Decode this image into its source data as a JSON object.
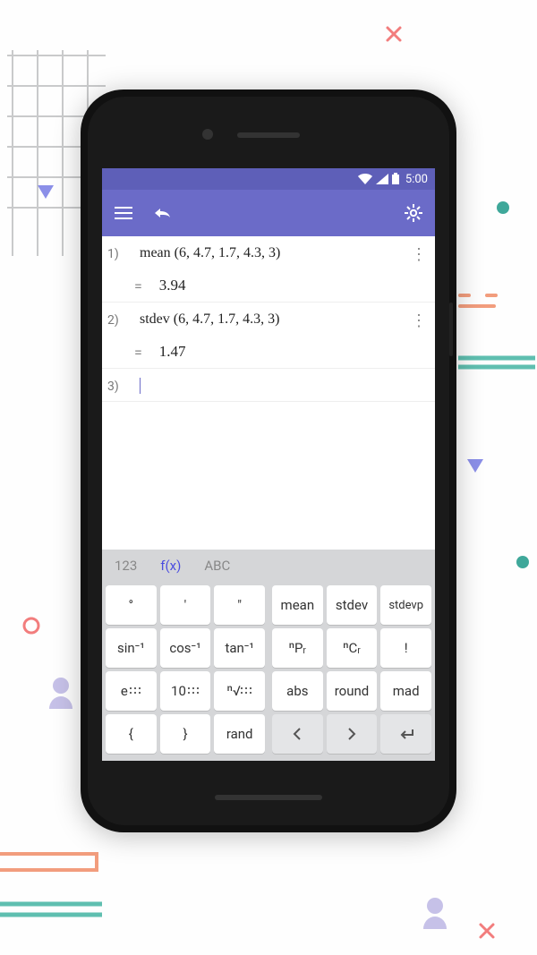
{
  "statusbar": {
    "time": "5:00"
  },
  "history": [
    {
      "num": "1)",
      "expr": "mean (6, 4.7, 1.7, 4.3, 3)",
      "result": "3.94"
    },
    {
      "num": "2)",
      "expr": "stdev (6, 4.7, 1.7, 4.3, 3)",
      "result": "1.47"
    },
    {
      "num": "3)",
      "expr": "",
      "result": null
    }
  ],
  "tabs": {
    "t1": "123",
    "t2": "f(x)",
    "t3": "ABC"
  },
  "keys_left": {
    "r1c1": "°",
    "r1c2": "'",
    "r1c3": "\"",
    "r2c1": "sin⁻¹",
    "r2c2": "cos⁻¹",
    "r2c3": "tan⁻¹",
    "r3c1": "e",
    "r3c2": "10",
    "r3c3_prefix": "ⁿ√",
    "r4c1": "{",
    "r4c2": "}",
    "r4c3": "rand"
  },
  "keys_right": {
    "r1c1": "mean",
    "r1c2": "stdev",
    "r1c3": "stdevp",
    "r2c1": "ⁿPᵣ",
    "r2c2": "ⁿCᵣ",
    "r2c3": "!",
    "r3c1": "abs",
    "r3c2": "round",
    "r3c3": "mad",
    "r4c1": "‹",
    "r4c2": "›",
    "r4c3": "↵"
  }
}
